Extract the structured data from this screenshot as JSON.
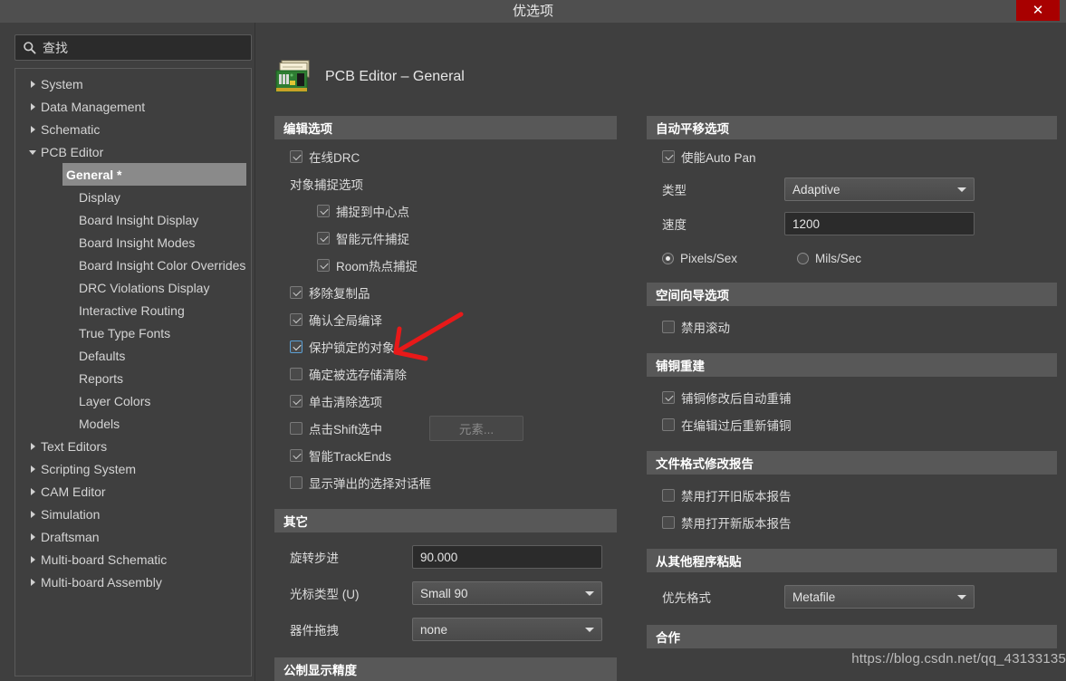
{
  "window": {
    "title": "优选项",
    "close_label": "✕"
  },
  "sidebar": {
    "search": {
      "placeholder": "查找",
      "value": "查找",
      "icon": "search-icon"
    },
    "items": [
      {
        "label": "System",
        "level": 0,
        "expandable": true,
        "expanded": false,
        "selected": false
      },
      {
        "label": "Data Management",
        "level": 0,
        "expandable": true,
        "expanded": false,
        "selected": false
      },
      {
        "label": "Schematic",
        "level": 0,
        "expandable": true,
        "expanded": false,
        "selected": false
      },
      {
        "label": "PCB Editor",
        "level": 0,
        "expandable": true,
        "expanded": true,
        "selected": false
      },
      {
        "label": "General *",
        "level": 1,
        "expandable": false,
        "expanded": false,
        "selected": true
      },
      {
        "label": "Display",
        "level": 1,
        "expandable": false,
        "expanded": false,
        "selected": false
      },
      {
        "label": "Board Insight Display",
        "level": 1,
        "expandable": false,
        "expanded": false,
        "selected": false
      },
      {
        "label": "Board Insight Modes",
        "level": 1,
        "expandable": false,
        "expanded": false,
        "selected": false
      },
      {
        "label": "Board Insight Color Overrides",
        "level": 1,
        "expandable": false,
        "expanded": false,
        "selected": false
      },
      {
        "label": "DRC Violations Display",
        "level": 1,
        "expandable": false,
        "expanded": false,
        "selected": false
      },
      {
        "label": "Interactive Routing",
        "level": 1,
        "expandable": false,
        "expanded": false,
        "selected": false
      },
      {
        "label": "True Type Fonts",
        "level": 1,
        "expandable": false,
        "expanded": false,
        "selected": false
      },
      {
        "label": "Defaults",
        "level": 1,
        "expandable": false,
        "expanded": false,
        "selected": false
      },
      {
        "label": "Reports",
        "level": 1,
        "expandable": false,
        "expanded": false,
        "selected": false
      },
      {
        "label": "Layer Colors",
        "level": 1,
        "expandable": false,
        "expanded": false,
        "selected": false
      },
      {
        "label": "Models",
        "level": 1,
        "expandable": false,
        "expanded": false,
        "selected": false
      },
      {
        "label": "Text Editors",
        "level": 0,
        "expandable": true,
        "expanded": false,
        "selected": false
      },
      {
        "label": "Scripting System",
        "level": 0,
        "expandable": true,
        "expanded": false,
        "selected": false
      },
      {
        "label": "CAM Editor",
        "level": 0,
        "expandable": true,
        "expanded": false,
        "selected": false
      },
      {
        "label": "Simulation",
        "level": 0,
        "expandable": true,
        "expanded": false,
        "selected": false
      },
      {
        "label": "Draftsman",
        "level": 0,
        "expandable": true,
        "expanded": false,
        "selected": false
      },
      {
        "label": "Multi-board Schematic",
        "level": 0,
        "expandable": true,
        "expanded": false,
        "selected": false
      },
      {
        "label": "Multi-board Assembly",
        "level": 0,
        "expandable": true,
        "expanded": false,
        "selected": false
      }
    ]
  },
  "page": {
    "title": "PCB Editor – General",
    "icon": "pcb-board-icon"
  },
  "left_column": {
    "editing_options": {
      "heading": "编辑选项",
      "online_drc": {
        "label": "在线DRC",
        "checked": true
      },
      "snap_group_label": "对象捕捉选项",
      "snap_center": {
        "label": "捕捉到中心点",
        "checked": true
      },
      "snap_smart_part": {
        "label": "智能元件捕捉",
        "checked": true
      },
      "snap_room_hot": {
        "label": "Room热点捕捉",
        "checked": true
      },
      "remove_dup": {
        "label": "移除复制品",
        "checked": true
      },
      "confirm_global": {
        "label": "确认全局编译",
        "checked": true
      },
      "protect_locked": {
        "label": "保护锁定的对象",
        "checked": true,
        "focused": true
      },
      "confirm_clear": {
        "label": "确定被选存储清除",
        "checked": false
      },
      "click_clears": {
        "label": "单击清除选项",
        "checked": true
      },
      "shift_click": {
        "label": "点击Shift选中",
        "checked": false
      },
      "shift_click_button": {
        "label": "元素...",
        "disabled": true
      },
      "smart_trackends": {
        "label": "智能TrackEnds",
        "checked": true
      },
      "show_popup": {
        "label": "显示弹出的选择对话框",
        "checked": false
      }
    },
    "other": {
      "heading": "其它",
      "rotation_step": {
        "label": "旋转步进",
        "value": "90.000"
      },
      "cursor_type": {
        "label": "光标类型 (U)",
        "value": "Small 90"
      },
      "comp_drag": {
        "label": "器件拖拽",
        "value": "none"
      }
    },
    "metric_display": {
      "heading": "公制显示精度"
    }
  },
  "right_column": {
    "auto_pan": {
      "heading": "自动平移选项",
      "enable": {
        "label": "使能Auto Pan",
        "checked": true
      },
      "type": {
        "label": "类型",
        "value": "Adaptive"
      },
      "speed": {
        "label": "速度",
        "value": "1200"
      },
      "units": {
        "pixels": {
          "label": "Pixels/Sex",
          "selected": true
        },
        "mils": {
          "label": "Mils/Sec",
          "selected": false
        }
      }
    },
    "space_navigator": {
      "heading": "空间向导选项",
      "disable_roll": {
        "label": "禁用滚动",
        "checked": false
      }
    },
    "polygon_rebuild": {
      "heading": "铺铜重建",
      "auto_repour": {
        "label": "铺铜修改后自动重铺",
        "checked": true
      },
      "repour_after_edit": {
        "label": "在编辑过后重新铺铜",
        "checked": false
      }
    },
    "file_format_report": {
      "heading": "文件格式修改报告",
      "disable_old": {
        "label": "禁用打开旧版本报告",
        "checked": false
      },
      "disable_new": {
        "label": "禁用打开新版本报告",
        "checked": false
      }
    },
    "paste_from_other": {
      "heading": "从其他程序粘贴",
      "preferred_format": {
        "label": "优先格式",
        "value": "Metafile"
      }
    },
    "collaboration": {
      "heading": "合作"
    }
  },
  "annotation": {
    "watermark": "https://blog.csdn.net/qq_43133135",
    "arrow_color": "#e81919"
  }
}
